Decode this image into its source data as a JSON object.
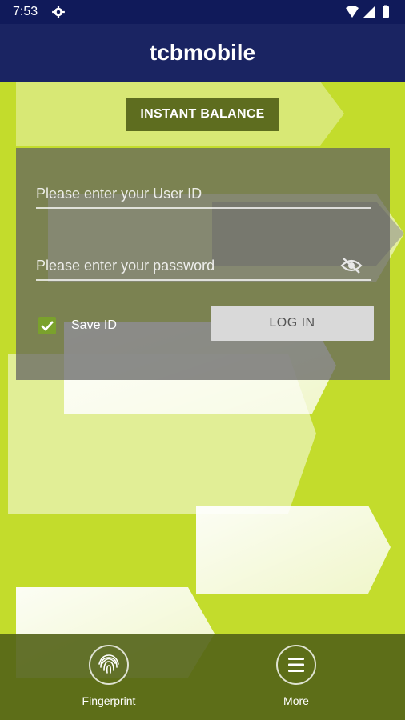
{
  "status_bar": {
    "time": "7:53",
    "icons": [
      "gear-icon",
      "wifi-icon",
      "signal-icon",
      "battery-icon"
    ]
  },
  "app_bar": {
    "title": "tcbmobile"
  },
  "instant_balance": {
    "label": "INSTANT BALANCE"
  },
  "login": {
    "user_id_placeholder": "Please enter your User ID",
    "password_placeholder": "Please enter your password",
    "password_visibility_icon": "eye-off-icon",
    "save_id_label": "Save ID",
    "save_id_checked": true,
    "login_button": "LOG IN"
  },
  "bottom_nav": {
    "fingerprint": {
      "label": "Fingerprint",
      "icon": "fingerprint-icon"
    },
    "more": {
      "label": "More",
      "icon": "menu-icon"
    }
  },
  "colors": {
    "app_bar": "#1a2462",
    "background": "#c3dc2c",
    "accent": "#5e6d1f"
  }
}
